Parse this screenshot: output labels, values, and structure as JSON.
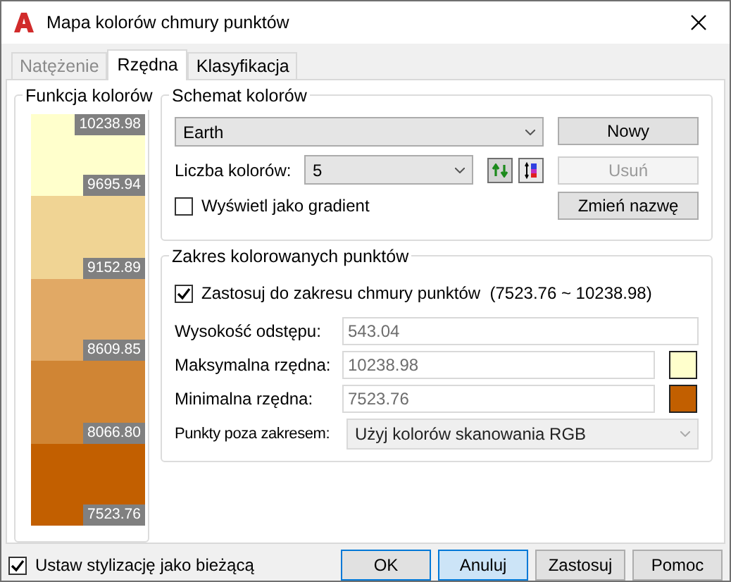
{
  "window": {
    "title": "Mapa kolorów chmury punktów"
  },
  "tabs": [
    {
      "label": "Natężenie",
      "selected": false,
      "disabled": true
    },
    {
      "label": "Rzędna",
      "selected": true,
      "disabled": false
    },
    {
      "label": "Klasyfikacja",
      "selected": false,
      "disabled": false
    }
  ],
  "color_function": {
    "title": "Funkcja kolorów",
    "bands": [
      {
        "color": "#ffffcc"
      },
      {
        "color": "#f0d494"
      },
      {
        "color": "#e1a965"
      },
      {
        "color": "#d08534"
      },
      {
        "color": "#c25f00"
      }
    ],
    "labels": [
      "10238.98",
      "9695.94",
      "9152.89",
      "8609.85",
      "8066.80",
      "7523.76"
    ]
  },
  "color_scheme": {
    "title": "Schemat kolorów",
    "scheme": "Earth",
    "count_label": "Liczba kolorów:",
    "count": "5",
    "gradient": {
      "label": "Wyświetl jako gradient",
      "checked": false
    },
    "buttons": [
      {
        "label": "Nowy",
        "disabled": false
      },
      {
        "label": "Usuń",
        "disabled": true
      },
      {
        "label": "Zmień nazwę",
        "disabled": false
      }
    ]
  },
  "range": {
    "title": "Zakres kolorowanych punktów",
    "apply": {
      "label": "Zastosuj do zakresu chmury punktów  (7523.76 ~ 10238.98)",
      "checked": true
    },
    "fields": [
      {
        "label": "Wysokość odstępu:",
        "value": "543.04"
      },
      {
        "label": "Maksymalna rzędna:",
        "value": "10238.98",
        "color": "#ffffcc"
      },
      {
        "label": "Minimalna rzędna:",
        "value": "7523.76",
        "color": "#c25f00"
      }
    ],
    "outside_label": "Punkty poza zakresem:",
    "outside_value": "Użyj kolorów skanowania RGB"
  },
  "set_current": {
    "label": "Ustaw stylizację jako bieżącą",
    "checked": true
  },
  "buttons": [
    {
      "label": "OK",
      "default": true,
      "hovered": false
    },
    {
      "label": "Anuluj",
      "default": false,
      "hovered": true
    },
    {
      "label": "Zastosuj",
      "default": false,
      "hovered": false
    },
    {
      "label": "Pomoc",
      "default": false,
      "hovered": false
    }
  ]
}
